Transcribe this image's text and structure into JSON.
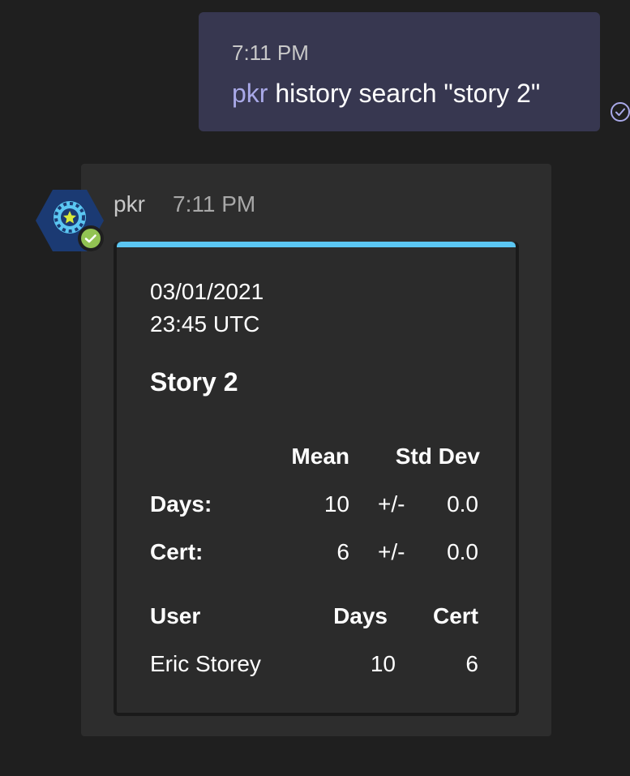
{
  "sent_message": {
    "time": "7:11 PM",
    "mention": "pkr",
    "text": " history search \"story 2\""
  },
  "received_message": {
    "sender": "pkr",
    "time": "7:11 PM"
  },
  "card": {
    "date": "03/01/2021",
    "time": "23:45 UTC",
    "title": "Story 2",
    "stats_headers": {
      "mean": "Mean",
      "std_dev": "Std Dev"
    },
    "stats_rows": [
      {
        "label": "Days:",
        "mean": "10",
        "pm": "+/-",
        "std": "0.0"
      },
      {
        "label": "Cert:",
        "mean": "6",
        "pm": "+/-",
        "std": "0.0"
      }
    ],
    "user_headers": {
      "user": "User",
      "days": "Days",
      "cert": "Cert"
    },
    "user_rows": [
      {
        "user": "Eric Storey",
        "days": "10",
        "cert": "6"
      }
    ]
  },
  "colors": {
    "background": "#1f1f1f",
    "sent_bubble": "#373750",
    "mention": "#a9a9e8",
    "card_accent": "#5bc6f2",
    "status_green": "#92c353"
  },
  "icons": {
    "read_receipt": "check-circle-icon",
    "avatar": "poker-chip-icon",
    "presence": "available-check-icon"
  }
}
